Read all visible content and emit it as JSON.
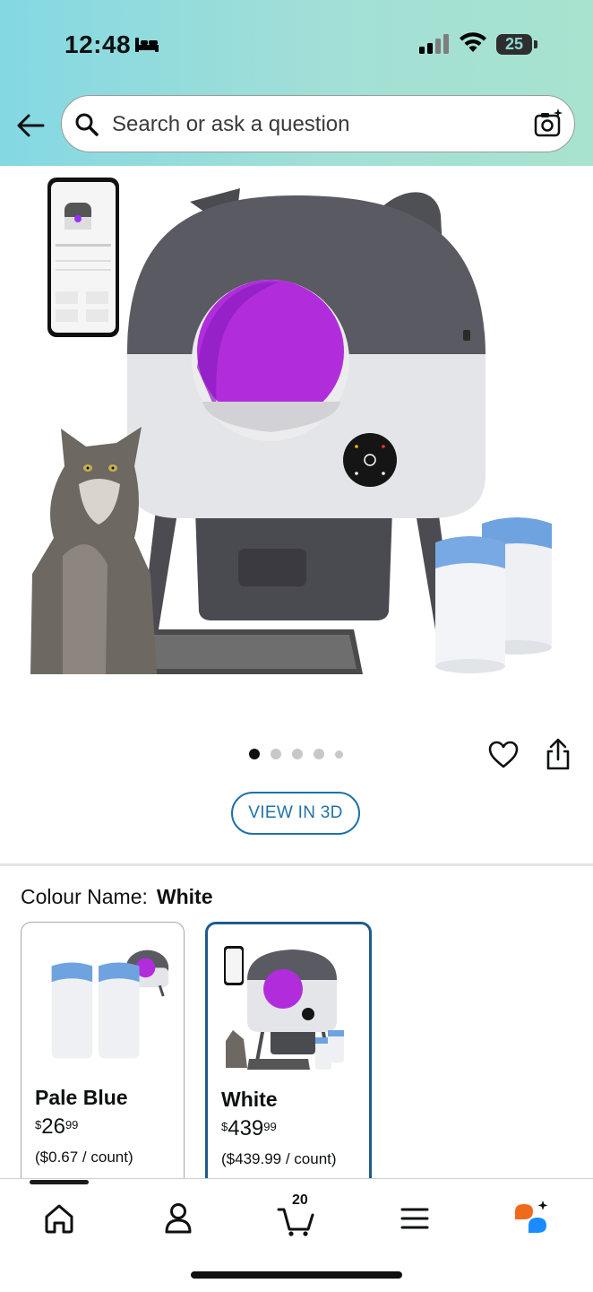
{
  "status_bar": {
    "time": "12:48",
    "battery": "25"
  },
  "search": {
    "placeholder": "Search or ask a question"
  },
  "product": {
    "carousel": {
      "total": 5,
      "active_index": 0
    },
    "view_3d_label": "VIEW IN 3D"
  },
  "colour": {
    "label": "Colour Name:",
    "selected": "White",
    "options": [
      {
        "name": "Pale Blue",
        "price_symbol": "$",
        "price_whole": "26",
        "price_fraction": "99",
        "unit_price": "($0.67 / count)",
        "selected": false
      },
      {
        "name": "White",
        "price_symbol": "$",
        "price_whole": "439",
        "price_fraction": "99",
        "unit_price": "($439.99 / count)",
        "selected": true
      }
    ]
  },
  "nav": {
    "items": [
      "home",
      "account",
      "cart",
      "menu",
      "rufus"
    ],
    "cart_count": "20",
    "active": "home"
  },
  "colors": {
    "accent": "#1f72a8",
    "selected_border": "#1f5b8e",
    "header_gradient_start": "#84d8e3",
    "header_gradient_end": "#a8e3cf",
    "rufus_orange": "#f06a1e",
    "rufus_blue": "#1a8cff"
  }
}
